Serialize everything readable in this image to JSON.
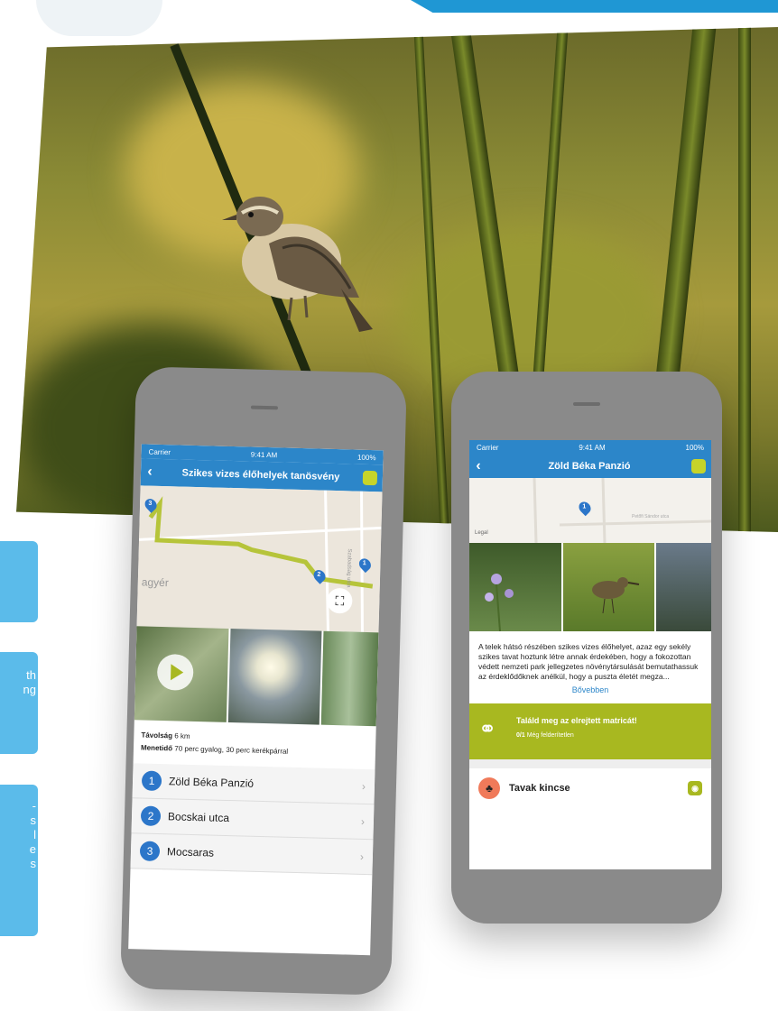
{
  "side_cards": [
    {
      "lines": [
        "",
        ""
      ]
    },
    {
      "lines": [
        "th",
        "ng"
      ]
    },
    {
      "lines": [
        "-",
        "s",
        "",
        "l",
        "",
        "e",
        "s"
      ]
    }
  ],
  "phone_left": {
    "status": {
      "carrier": "Carrier",
      "time": "9:41 AM",
      "battery": "100%"
    },
    "nav_title": "Szikes vizes élőhelyek tanösvény",
    "map_label": "agyér",
    "map_street": "Szabadság utca",
    "pins": [
      "3",
      "2",
      "1"
    ],
    "distance_label": "Távolság",
    "distance_value": "6 km",
    "duration_label": "Menetidő",
    "duration_value": "70 perc gyalog, 30 perc kerékpárral",
    "stops": [
      {
        "num": "1",
        "name": "Zöld Béka Panzió"
      },
      {
        "num": "2",
        "name": "Bocskai utca"
      },
      {
        "num": "3",
        "name": "Mocsaras"
      }
    ]
  },
  "phone_right": {
    "status": {
      "carrier": "Carrier",
      "time": "9:41 AM",
      "battery": "100%"
    },
    "nav_title": "Zöld Béka Panzió",
    "map_pin": "1",
    "map_label": "Legal",
    "map_street": "Petőfi Sándor utca",
    "description": "A telek hátsó részében szikes vizes élőhelyet, azaz egy sekély szikes tavat hoztunk létre annak érdekében, hogy a fokozottan védett nemzeti park jellegzetes növénytársulását bemutathassuk az érdeklődőknek anélkül, hogy a puszta életét megza...",
    "more_link": "Bővebben",
    "challenge_title": "Találd meg az elrejtett matricát!",
    "challenge_count": "0/1",
    "challenge_status": "Még felderítetlen",
    "treasure_label": "Tavak kincse"
  },
  "colors": {
    "accent_blue": "#2c86c9",
    "lime": "#a8b820",
    "side_card": "#5bbbea"
  }
}
